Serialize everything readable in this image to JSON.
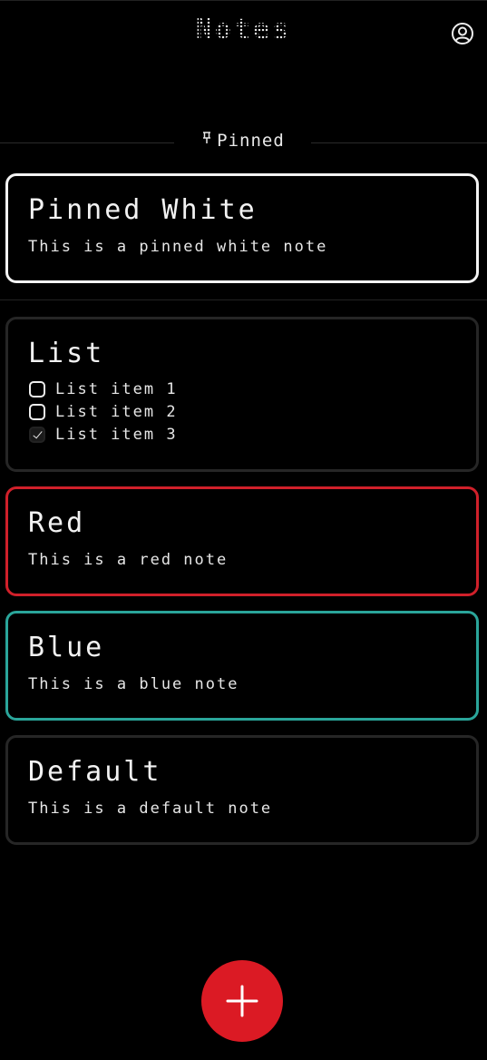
{
  "header": {
    "app_title": "Notes",
    "profile_icon": "user-circle-icon"
  },
  "pinned_section": {
    "label": "Pinned",
    "icon": "pin-icon"
  },
  "notes": {
    "pinned_white": {
      "title": "Pinned White",
      "body": "This is a pinned white note",
      "border_color": "#f4f4f4"
    },
    "list": {
      "title": "List",
      "items": [
        {
          "label": "List item 1",
          "checked": false
        },
        {
          "label": "List item 2",
          "checked": false
        },
        {
          "label": "List item 3",
          "checked": true
        }
      ]
    },
    "red": {
      "title": "Red",
      "body": "This is a red note",
      "border_color": "#d0202a"
    },
    "blue": {
      "title": "Blue",
      "body": "This is a blue note",
      "border_color": "#2aa59a"
    },
    "default": {
      "title": "Default",
      "body": "This is a default note",
      "border_color": "#262626"
    }
  },
  "fab": {
    "icon": "plus-icon",
    "color": "#db1a24"
  }
}
